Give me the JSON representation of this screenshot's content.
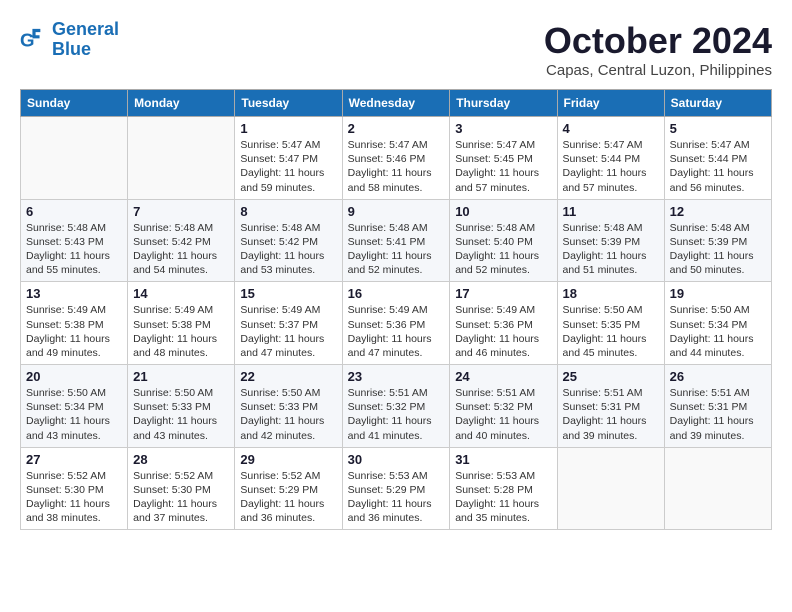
{
  "header": {
    "logo_line1": "General",
    "logo_line2": "Blue",
    "month": "October 2024",
    "location": "Capas, Central Luzon, Philippines"
  },
  "weekdays": [
    "Sunday",
    "Monday",
    "Tuesday",
    "Wednesday",
    "Thursday",
    "Friday",
    "Saturday"
  ],
  "weeks": [
    [
      {
        "day": "",
        "sunrise": "",
        "sunset": "",
        "daylight": ""
      },
      {
        "day": "",
        "sunrise": "",
        "sunset": "",
        "daylight": ""
      },
      {
        "day": "1",
        "sunrise": "Sunrise: 5:47 AM",
        "sunset": "Sunset: 5:47 PM",
        "daylight": "Daylight: 11 hours and 59 minutes."
      },
      {
        "day": "2",
        "sunrise": "Sunrise: 5:47 AM",
        "sunset": "Sunset: 5:46 PM",
        "daylight": "Daylight: 11 hours and 58 minutes."
      },
      {
        "day": "3",
        "sunrise": "Sunrise: 5:47 AM",
        "sunset": "Sunset: 5:45 PM",
        "daylight": "Daylight: 11 hours and 57 minutes."
      },
      {
        "day": "4",
        "sunrise": "Sunrise: 5:47 AM",
        "sunset": "Sunset: 5:44 PM",
        "daylight": "Daylight: 11 hours and 57 minutes."
      },
      {
        "day": "5",
        "sunrise": "Sunrise: 5:47 AM",
        "sunset": "Sunset: 5:44 PM",
        "daylight": "Daylight: 11 hours and 56 minutes."
      }
    ],
    [
      {
        "day": "6",
        "sunrise": "Sunrise: 5:48 AM",
        "sunset": "Sunset: 5:43 PM",
        "daylight": "Daylight: 11 hours and 55 minutes."
      },
      {
        "day": "7",
        "sunrise": "Sunrise: 5:48 AM",
        "sunset": "Sunset: 5:42 PM",
        "daylight": "Daylight: 11 hours and 54 minutes."
      },
      {
        "day": "8",
        "sunrise": "Sunrise: 5:48 AM",
        "sunset": "Sunset: 5:42 PM",
        "daylight": "Daylight: 11 hours and 53 minutes."
      },
      {
        "day": "9",
        "sunrise": "Sunrise: 5:48 AM",
        "sunset": "Sunset: 5:41 PM",
        "daylight": "Daylight: 11 hours and 52 minutes."
      },
      {
        "day": "10",
        "sunrise": "Sunrise: 5:48 AM",
        "sunset": "Sunset: 5:40 PM",
        "daylight": "Daylight: 11 hours and 52 minutes."
      },
      {
        "day": "11",
        "sunrise": "Sunrise: 5:48 AM",
        "sunset": "Sunset: 5:39 PM",
        "daylight": "Daylight: 11 hours and 51 minutes."
      },
      {
        "day": "12",
        "sunrise": "Sunrise: 5:48 AM",
        "sunset": "Sunset: 5:39 PM",
        "daylight": "Daylight: 11 hours and 50 minutes."
      }
    ],
    [
      {
        "day": "13",
        "sunrise": "Sunrise: 5:49 AM",
        "sunset": "Sunset: 5:38 PM",
        "daylight": "Daylight: 11 hours and 49 minutes."
      },
      {
        "day": "14",
        "sunrise": "Sunrise: 5:49 AM",
        "sunset": "Sunset: 5:38 PM",
        "daylight": "Daylight: 11 hours and 48 minutes."
      },
      {
        "day": "15",
        "sunrise": "Sunrise: 5:49 AM",
        "sunset": "Sunset: 5:37 PM",
        "daylight": "Daylight: 11 hours and 47 minutes."
      },
      {
        "day": "16",
        "sunrise": "Sunrise: 5:49 AM",
        "sunset": "Sunset: 5:36 PM",
        "daylight": "Daylight: 11 hours and 47 minutes."
      },
      {
        "day": "17",
        "sunrise": "Sunrise: 5:49 AM",
        "sunset": "Sunset: 5:36 PM",
        "daylight": "Daylight: 11 hours and 46 minutes."
      },
      {
        "day": "18",
        "sunrise": "Sunrise: 5:50 AM",
        "sunset": "Sunset: 5:35 PM",
        "daylight": "Daylight: 11 hours and 45 minutes."
      },
      {
        "day": "19",
        "sunrise": "Sunrise: 5:50 AM",
        "sunset": "Sunset: 5:34 PM",
        "daylight": "Daylight: 11 hours and 44 minutes."
      }
    ],
    [
      {
        "day": "20",
        "sunrise": "Sunrise: 5:50 AM",
        "sunset": "Sunset: 5:34 PM",
        "daylight": "Daylight: 11 hours and 43 minutes."
      },
      {
        "day": "21",
        "sunrise": "Sunrise: 5:50 AM",
        "sunset": "Sunset: 5:33 PM",
        "daylight": "Daylight: 11 hours and 43 minutes."
      },
      {
        "day": "22",
        "sunrise": "Sunrise: 5:50 AM",
        "sunset": "Sunset: 5:33 PM",
        "daylight": "Daylight: 11 hours and 42 minutes."
      },
      {
        "day": "23",
        "sunrise": "Sunrise: 5:51 AM",
        "sunset": "Sunset: 5:32 PM",
        "daylight": "Daylight: 11 hours and 41 minutes."
      },
      {
        "day": "24",
        "sunrise": "Sunrise: 5:51 AM",
        "sunset": "Sunset: 5:32 PM",
        "daylight": "Daylight: 11 hours and 40 minutes."
      },
      {
        "day": "25",
        "sunrise": "Sunrise: 5:51 AM",
        "sunset": "Sunset: 5:31 PM",
        "daylight": "Daylight: 11 hours and 39 minutes."
      },
      {
        "day": "26",
        "sunrise": "Sunrise: 5:51 AM",
        "sunset": "Sunset: 5:31 PM",
        "daylight": "Daylight: 11 hours and 39 minutes."
      }
    ],
    [
      {
        "day": "27",
        "sunrise": "Sunrise: 5:52 AM",
        "sunset": "Sunset: 5:30 PM",
        "daylight": "Daylight: 11 hours and 38 minutes."
      },
      {
        "day": "28",
        "sunrise": "Sunrise: 5:52 AM",
        "sunset": "Sunset: 5:30 PM",
        "daylight": "Daylight: 11 hours and 37 minutes."
      },
      {
        "day": "29",
        "sunrise": "Sunrise: 5:52 AM",
        "sunset": "Sunset: 5:29 PM",
        "daylight": "Daylight: 11 hours and 36 minutes."
      },
      {
        "day": "30",
        "sunrise": "Sunrise: 5:53 AM",
        "sunset": "Sunset: 5:29 PM",
        "daylight": "Daylight: 11 hours and 36 minutes."
      },
      {
        "day": "31",
        "sunrise": "Sunrise: 5:53 AM",
        "sunset": "Sunset: 5:28 PM",
        "daylight": "Daylight: 11 hours and 35 minutes."
      },
      {
        "day": "",
        "sunrise": "",
        "sunset": "",
        "daylight": ""
      },
      {
        "day": "",
        "sunrise": "",
        "sunset": "",
        "daylight": ""
      }
    ]
  ]
}
